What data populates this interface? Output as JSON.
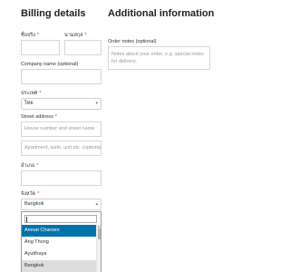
{
  "billing": {
    "heading": "Billing details",
    "first_name_label": "ชื่อจริง",
    "last_name_label": "นามสกุล",
    "company_label": "Company name (optional)",
    "country_label": "ประเทศ",
    "country_value": "ไทย",
    "street_label": "Street address",
    "street_placeholder": "House number and street name",
    "street2_placeholder": "Apartment, suite, unit etc. (optional)",
    "district_label": "อำเภอ",
    "province_label": "จังหวัด",
    "province_value": "Bangkok",
    "required_mark": "*"
  },
  "additional": {
    "heading": "Additional information",
    "notes_label": "Order notes (optional)",
    "notes_placeholder": "Notes about your order, e.g. special notes for delivery."
  },
  "province_dropdown": {
    "search_value": "",
    "options": [
      "Amnat Charoen",
      "Ang Thong",
      "Ayutthaya",
      "Bangkok"
    ],
    "highlighted_index": 0,
    "selected_index": 3
  },
  "colors": {
    "accent_highlight": "#0073aa",
    "required": "#d12c2c"
  }
}
